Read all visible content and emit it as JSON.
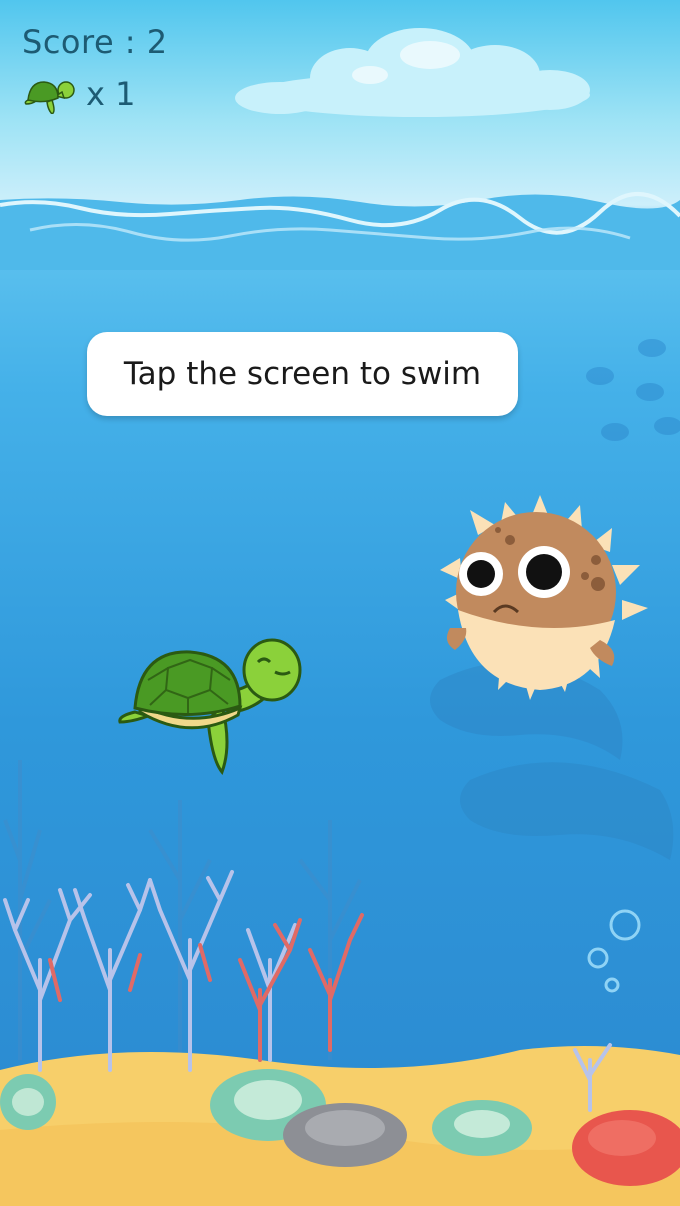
{
  "hud": {
    "score_label": "Score : 2",
    "lives_icon": "turtle-icon",
    "lives_text": "x 1"
  },
  "hint": {
    "text": "Tap the screen to swim"
  },
  "characters": {
    "player": "sea-turtle",
    "obstacle": "pufferfish"
  },
  "colors": {
    "sky_top": "#51c6ee",
    "water": "#3aa3e3",
    "sand": "#f7cf6a",
    "turtle_shell": "#4a9a24",
    "turtle_skin": "#8bd13a",
    "puffer_body": "#c18a5e",
    "puffer_belly": "#fbe1b7",
    "coral_red": "#e8564d"
  }
}
